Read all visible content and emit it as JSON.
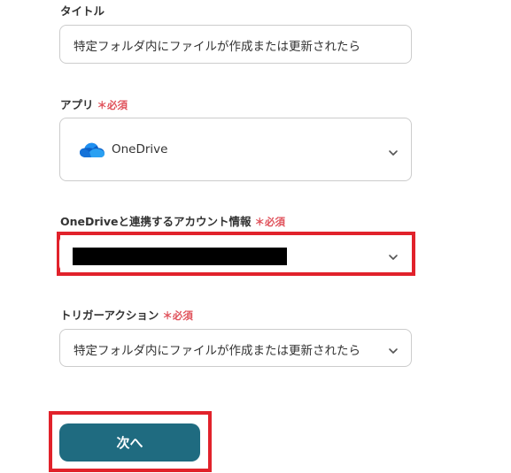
{
  "title_field": {
    "label": "タイトル",
    "value": "特定フォルダ内にファイルが作成または更新されたら"
  },
  "app_field": {
    "label": "アプリ",
    "required_mark": "＊必須",
    "value": "OneDrive",
    "icon": "onedrive-cloud-icon"
  },
  "account_field": {
    "label": "OneDriveと連携するアカウント情報",
    "required_mark": "＊必須",
    "value_redacted": true
  },
  "trigger_field": {
    "label": "トリガーアクション",
    "required_mark": "＊必須",
    "value": "特定フォルダ内にファイルが作成または更新されたら"
  },
  "next_button": {
    "label": "次へ"
  },
  "colors": {
    "accent_button": "#1f6b80",
    "required_red": "#e0525b",
    "highlight_red": "#e1222b",
    "onedrive_blue": "#1a73d9"
  }
}
